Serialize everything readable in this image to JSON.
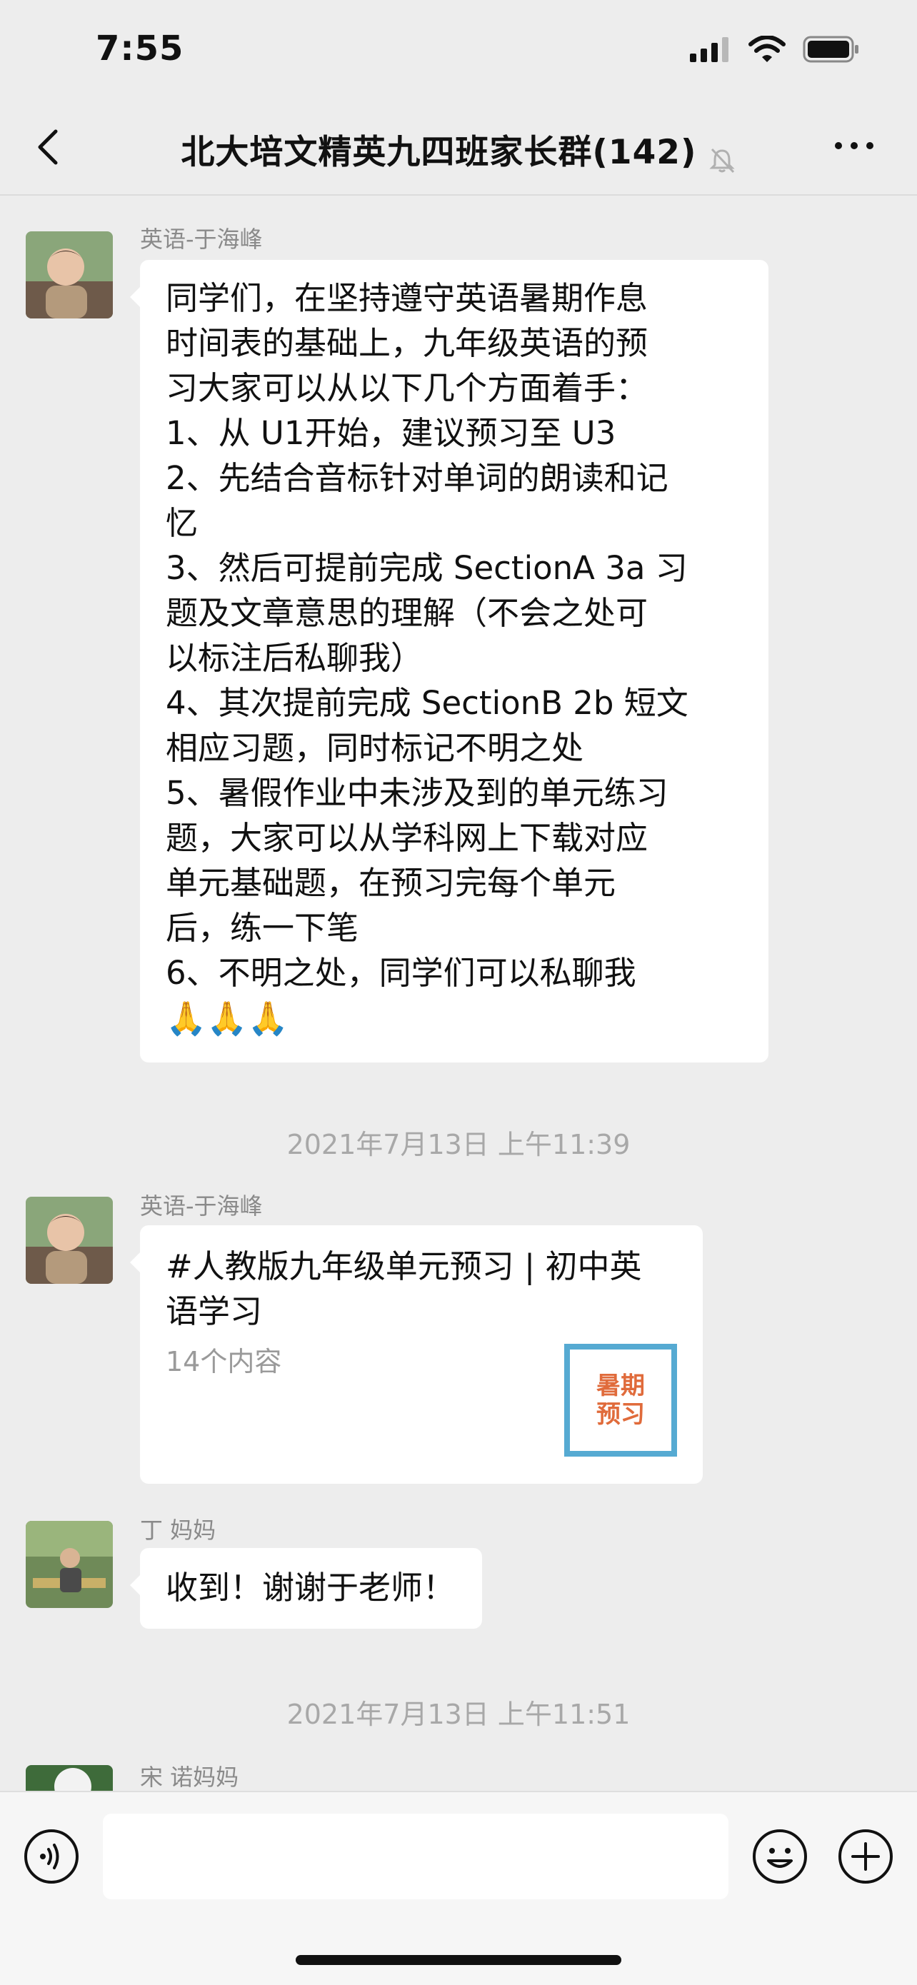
{
  "status_bar": {
    "time": "7:55",
    "icons": [
      "signal-icon",
      "wifi-icon",
      "battery-icon"
    ]
  },
  "nav": {
    "title": "北大培文精英九四班家长群(142)",
    "icons": [
      "back-icon",
      "mute-bell-icon",
      "more-icon"
    ]
  },
  "messages": [
    {
      "type": "text",
      "sender": "英语-于海峰",
      "text": "同学们，在坚持遵守英语暑期作息\n时间表的基础上，九年级英语的预\n习大家可以从以下几个方面着手：\n1、从 U1开始，建议预习至 U3\n2、先结合音标针对单词的朗读和记\n忆\n3、然后可提前完成 SectionA 3a 习\n题及文章意思的理解（不会之处可\n以标注后私聊我）\n4、其次提前完成 SectionB 2b 短文\n相应习题，同时标记不明之处\n5、暑假作业中未涉及到的单元练习\n题，大家可以从学科网上下载对应\n单元基础题，在预习完每个单元\n后，练一下笔\n6、不明之处，同学们可以私聊我",
      "emoji": "🙏🙏🙏"
    },
    {
      "type": "link",
      "sender": "英语-于海峰",
      "title": "#人教版九年级单元预习 | 初中英语学习",
      "subtitle": "14个内容",
      "thumb_line1": "暑期",
      "thumb_line2": "预习"
    },
    {
      "type": "text",
      "sender": "丁 妈妈",
      "text": "收到！谢谢于老师！"
    },
    {
      "type": "partial",
      "sender": "宋 诺妈妈"
    }
  ],
  "timestamps": [
    "2021年7月13日 上午11:39",
    "2021年7月13日 上午11:51"
  ],
  "input": {
    "value": "",
    "icons": [
      "voice-icon",
      "emoji-icon",
      "plus-icon"
    ]
  },
  "colors": {
    "background": "#ededed",
    "bubble": "#ffffff",
    "timestamp": "#a8a8a8"
  }
}
